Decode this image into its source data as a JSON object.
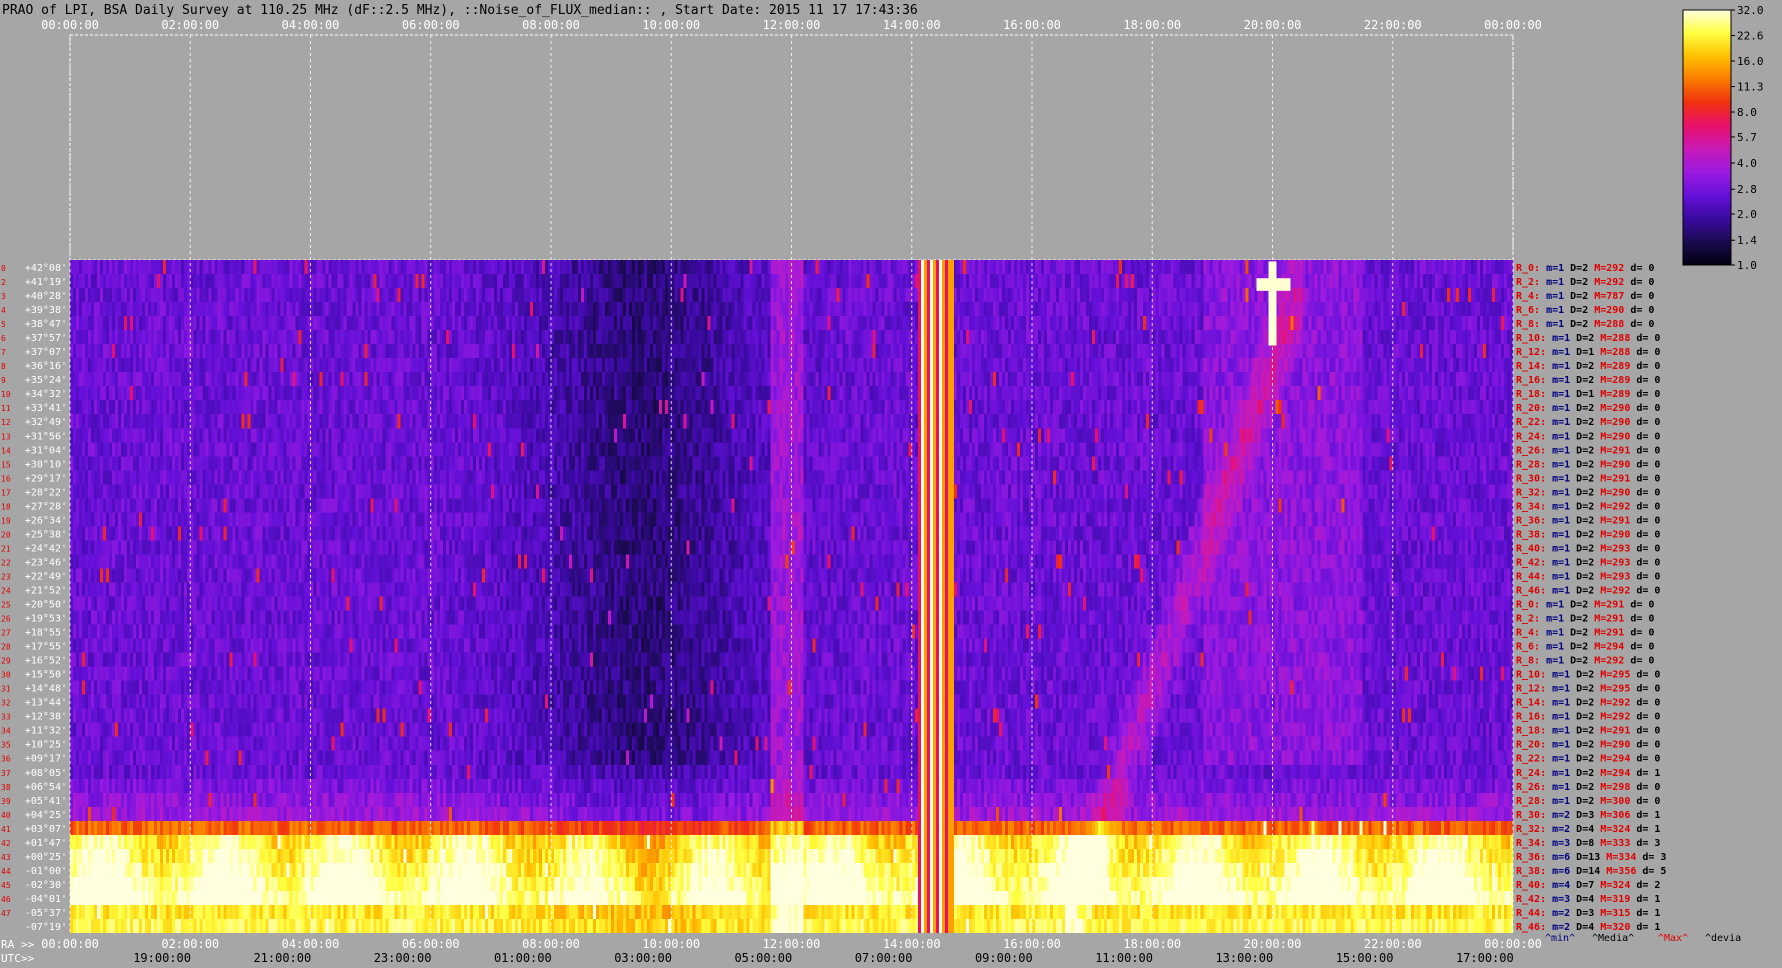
{
  "chart_data": {
    "type": "heatmap",
    "title": "PRAO of LPI, BSA Daily Survey at 110.25 MHz (dF::2.5 MHz), ::Noise_of_FLUX_median:: , Start Date: 2015 11 17 17:43:36",
    "top_time_labels": [
      "00:00:00",
      "02:00:00",
      "04:00:00",
      "06:00:00",
      "08:00:00",
      "10:00:00",
      "12:00:00",
      "14:00:00",
      "16:00:00",
      "18:00:00",
      "20:00:00",
      "22:00:00",
      "00:00:00"
    ],
    "ra_axis_prefix": "RA >>",
    "ra_labels": [
      "00:00:00",
      "02:00:00",
      "04:00:00",
      "06:00:00",
      "08:00:00",
      "10:00:00",
      "12:00:00",
      "14:00:00",
      "16:00:00",
      "18:00:00",
      "20:00:00",
      "22:00:00",
      "00:00:00"
    ],
    "utc_axis_prefix": "UTC>>",
    "utc_labels": [
      "19:00:00",
      "21:00:00",
      "23:00:00",
      "01:00:00",
      "03:00:00",
      "05:00:00",
      "07:00:00",
      "09:00:00",
      "11:00:00",
      "13:00:00",
      "15:00:00",
      "17:00:00"
    ],
    "declinations": [
      "+42°08'",
      "+41°19'",
      "+40°28'",
      "+39°38'",
      "+38°47'",
      "+37°57'",
      "+37°07'",
      "+36°16'",
      "+35°24'",
      "+34°32'",
      "+33°41'",
      "+32°49'",
      "+31°56'",
      "+31°04'",
      "+30°10'",
      "+29°17'",
      "+28°22'",
      "+27°28'",
      "+26°34'",
      "+25°38'",
      "+24°42'",
      "+23°46'",
      "+22°49'",
      "+21°52'",
      "+20°50'",
      "+19°53'",
      "+18°55'",
      "+17°55'",
      "+16°52'",
      "+15°50'",
      "+14°48'",
      "+13°44'",
      "+12°38'",
      "+11°32'",
      "+10°25'",
      "+09°17'",
      "+08°05'",
      "+06°54'",
      "+05°41'",
      "+04°25'",
      "+03°07'",
      "+01°47'",
      "+00°25'",
      "-01°00'",
      "-02°30'",
      "-04°01'",
      "-05°37'",
      "-07°19'"
    ],
    "beam_labels": [
      "0",
      "2",
      "3",
      "4",
      "5",
      "6",
      "7",
      "8",
      "9",
      "10",
      "11",
      "12",
      "13",
      "14",
      "15",
      "16",
      "17",
      "18",
      "19",
      "20",
      "21",
      "22",
      "23",
      "24",
      "25",
      "26",
      "27",
      "28",
      "29",
      "30",
      "31",
      "32",
      "33",
      "34",
      "35",
      "36",
      "37",
      "38",
      "39",
      "40",
      "41",
      "42",
      "43",
      "44",
      "45",
      "46",
      "47"
    ],
    "stats": [
      {
        "r": "R_0:",
        "m": "m=1",
        "D": "D=2",
        "M": "M=292",
        "d": "d= 0"
      },
      {
        "r": "R_2:",
        "m": "m=1",
        "D": "D=2",
        "M": "M=292",
        "d": "d= 0"
      },
      {
        "r": "R_4:",
        "m": "m=1",
        "D": "D=2",
        "M": "M=787",
        "d": "d= 0"
      },
      {
        "r": "R_6:",
        "m": "m=1",
        "D": "D=2",
        "M": "M=290",
        "d": "d= 0"
      },
      {
        "r": "R_8:",
        "m": "m=1",
        "D": "D=2",
        "M": "M=288",
        "d": "d= 0"
      },
      {
        "r": "R_10:",
        "m": "m=1",
        "D": "D=2",
        "M": "M=288",
        "d": "d= 0"
      },
      {
        "r": "R_12:",
        "m": "m=1",
        "D": "D=1",
        "M": "M=288",
        "d": "d= 0"
      },
      {
        "r": "R_14:",
        "m": "m=1",
        "D": "D=2",
        "M": "M=289",
        "d": "d= 0"
      },
      {
        "r": "R_16:",
        "m": "m=1",
        "D": "D=2",
        "M": "M=289",
        "d": "d= 0"
      },
      {
        "r": "R_18:",
        "m": "m=1",
        "D": "D=1",
        "M": "M=289",
        "d": "d= 0"
      },
      {
        "r": "R_20:",
        "m": "m=1",
        "D": "D=2",
        "M": "M=290",
        "d": "d= 0"
      },
      {
        "r": "R_22:",
        "m": "m=1",
        "D": "D=2",
        "M": "M=290",
        "d": "d= 0"
      },
      {
        "r": "R_24:",
        "m": "m=1",
        "D": "D=2",
        "M": "M=290",
        "d": "d= 0"
      },
      {
        "r": "R_26:",
        "m": "m=1",
        "D": "D=2",
        "M": "M=291",
        "d": "d= 0"
      },
      {
        "r": "R_28:",
        "m": "m=1",
        "D": "D=2",
        "M": "M=290",
        "d": "d= 0"
      },
      {
        "r": "R_30:",
        "m": "m=1",
        "D": "D=2",
        "M": "M=291",
        "d": "d= 0"
      },
      {
        "r": "R_32:",
        "m": "m=1",
        "D": "D=2",
        "M": "M=290",
        "d": "d= 0"
      },
      {
        "r": "R_34:",
        "m": "m=1",
        "D": "D=2",
        "M": "M=292",
        "d": "d= 0"
      },
      {
        "r": "R_36:",
        "m": "m=1",
        "D": "D=2",
        "M": "M=291",
        "d": "d= 0"
      },
      {
        "r": "R_38:",
        "m": "m=1",
        "D": "D=2",
        "M": "M=290",
        "d": "d= 0"
      },
      {
        "r": "R_40:",
        "m": "m=1",
        "D": "D=2",
        "M": "M=293",
        "d": "d= 0"
      },
      {
        "r": "R_42:",
        "m": "m=1",
        "D": "D=2",
        "M": "M=293",
        "d": "d= 0"
      },
      {
        "r": "R_44:",
        "m": "m=1",
        "D": "D=2",
        "M": "M=293",
        "d": "d= 0"
      },
      {
        "r": "R_46:",
        "m": "m=1",
        "D": "D=2",
        "M": "M=292",
        "d": "d= 0"
      },
      {
        "r": "R_0:",
        "m": "m=1",
        "D": "D=2",
        "M": "M=291",
        "d": "d= 0"
      },
      {
        "r": "R_2:",
        "m": "m=1",
        "D": "D=2",
        "M": "M=291",
        "d": "d= 0"
      },
      {
        "r": "R_4:",
        "m": "m=1",
        "D": "D=2",
        "M": "M=291",
        "d": "d= 0"
      },
      {
        "r": "R_6:",
        "m": "m=1",
        "D": "D=2",
        "M": "M=294",
        "d": "d= 0"
      },
      {
        "r": "R_8:",
        "m": "m=1",
        "D": "D=2",
        "M": "M=292",
        "d": "d= 0"
      },
      {
        "r": "R_10:",
        "m": "m=1",
        "D": "D=2",
        "M": "M=295",
        "d": "d= 0"
      },
      {
        "r": "R_12:",
        "m": "m=1",
        "D": "D=2",
        "M": "M=295",
        "d": "d= 0"
      },
      {
        "r": "R_14:",
        "m": "m=1",
        "D": "D=2",
        "M": "M=292",
        "d": "d= 0"
      },
      {
        "r": "R_16:",
        "m": "m=1",
        "D": "D=2",
        "M": "M=292",
        "d": "d= 0"
      },
      {
        "r": "R_18:",
        "m": "m=1",
        "D": "D=2",
        "M": "M=291",
        "d": "d= 0"
      },
      {
        "r": "R_20:",
        "m": "m=1",
        "D": "D=2",
        "M": "M=290",
        "d": "d= 0"
      },
      {
        "r": "R_22:",
        "m": "m=1",
        "D": "D=2",
        "M": "M=294",
        "d": "d= 0"
      },
      {
        "r": "R_24:",
        "m": "m=1",
        "D": "D=2",
        "M": "M=294",
        "d": "d= 1"
      },
      {
        "r": "R_26:",
        "m": "m=1",
        "D": "D=2",
        "M": "M=298",
        "d": "d= 0"
      },
      {
        "r": "R_28:",
        "m": "m=1",
        "D": "D=2",
        "M": "M=300",
        "d": "d= 0"
      },
      {
        "r": "R_30:",
        "m": "m=2",
        "D": "D=3",
        "M": "M=306",
        "d": "d= 1"
      },
      {
        "r": "R_32:",
        "m": "m=2",
        "D": "D=4",
        "M": "M=324",
        "d": "d= 1"
      },
      {
        "r": "R_34:",
        "m": "m=3",
        "D": "D=8",
        "M": "M=333",
        "d": "d= 3"
      },
      {
        "r": "R_36:",
        "m": "m=6",
        "D": "D=13",
        "M": "M=334",
        "d": "d= 3"
      },
      {
        "r": "R_38:",
        "m": "m=6",
        "D": "D=14",
        "M": "M=356",
        "d": "d= 5"
      },
      {
        "r": "R_40:",
        "m": "m=4",
        "D": "D=7",
        "M": "M=324",
        "d": "d= 2"
      },
      {
        "r": "R_42:",
        "m": "m=3",
        "D": "D=4",
        "M": "M=319",
        "d": "d= 1"
      },
      {
        "r": "R_44:",
        "m": "m=2",
        "D": "D=3",
        "M": "M=315",
        "d": "d= 1"
      },
      {
        "r": "R_46:",
        "m": "m=2",
        "D": "D=4",
        "M": "M=320",
        "d": "d= 1"
      }
    ],
    "stats_legend": [
      "^min^",
      "^Media^",
      "^Max^",
      "^devia"
    ],
    "colorbar_labels": [
      "32.0",
      "22.6",
      "16.0",
      "11.3",
      "8.0",
      "5.7",
      "4.0",
      "2.8",
      "2.0",
      "1.4",
      "1.0"
    ],
    "colorbar_values": [
      32.0,
      22.6,
      16.0,
      11.3,
      8.0,
      5.7,
      4.0,
      2.8,
      2.0,
      1.4,
      1.0
    ],
    "colorbar_scale": "log2",
    "colormap": [
      "#000010",
      "#1a0a50",
      "#3a0aa0",
      "#6410d8",
      "#9a1ae0",
      "#c81ab8",
      "#e8106a",
      "#f03010",
      "#fa7a00",
      "#ffc000",
      "#ffff40",
      "#ffffe0"
    ],
    "grid": true,
    "bright_features": [
      {
        "ra": "14:00–14:45",
        "decl": "all",
        "intensity": "32.0"
      },
      {
        "ra": "all",
        "decl": "+03°07' to -07°19'",
        "intensity": "16.0–32.0"
      },
      {
        "ra": "20:00",
        "decl": "+41°19' to +37°07'",
        "intensity": "32.0"
      }
    ]
  },
  "colors": {
    "background": "#a6a6a6",
    "title_text": "#000000",
    "axis_text_top": "#ffffff",
    "declination_text": "#ffffff",
    "beam_index_text": "#e00000",
    "stat_R": "#e00000",
    "stat_m": "#000080",
    "stat_D": "#000000",
    "stat_M": "#e00000",
    "stat_d": "#000000"
  }
}
